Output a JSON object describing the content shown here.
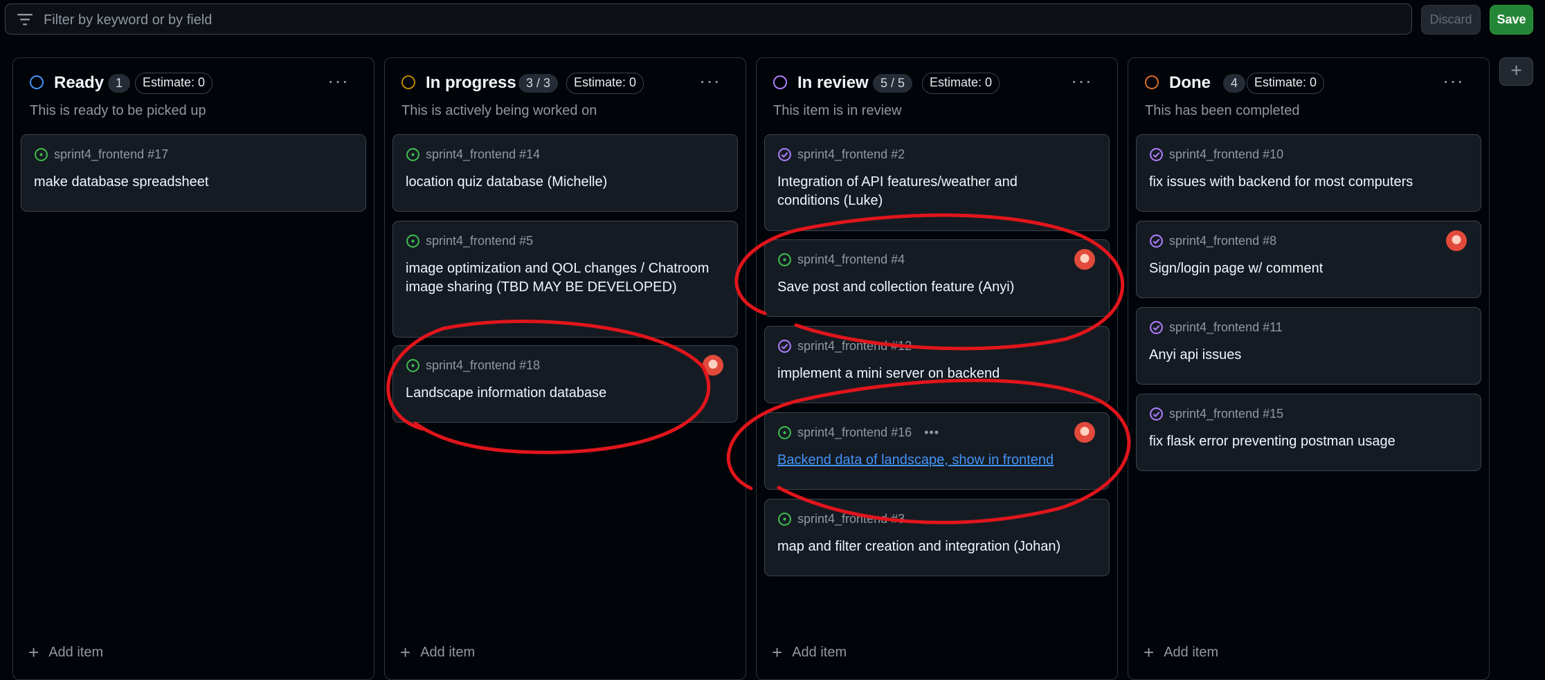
{
  "filter": {
    "placeholder": "Filter by keyword or by field"
  },
  "actions": {
    "discard_label": "Discard",
    "save_label": "Save"
  },
  "colors": {
    "ready": "#4493f8",
    "in_progress": "#bf8700",
    "in_review": "#ab7df8",
    "done": "#db6d28",
    "open_issue": "#3fb950",
    "closed_issue": "#ab7df8",
    "annotation": "#e0151c"
  },
  "columns": [
    {
      "id": "ready",
      "title": "Ready",
      "count": "1",
      "estimate": "Estimate: 0",
      "description": "This is ready to be picked up",
      "menu_icon": "kebab-horizontal-icon",
      "add_label": "Add item",
      "cards": [
        {
          "icon": "open-issue-icon",
          "repo": "sprint4_frontend #17",
          "title": "make database spreadsheet"
        }
      ]
    },
    {
      "id": "in-progress",
      "title": "In progress",
      "count": "3 / 3",
      "estimate": "Estimate: 0",
      "description": "This is actively being worked on",
      "menu_icon": "kebab-horizontal-icon",
      "add_label": "Add item",
      "cards": [
        {
          "icon": "open-issue-icon",
          "repo": "sprint4_frontend #14",
          "title": "location quiz database (Michelle)"
        },
        {
          "icon": "open-issue-icon",
          "repo": "sprint4_frontend #5",
          "title": "image optimization and QOL changes / Chatroom image sharing (TBD MAY BE DEVELOPED)"
        },
        {
          "icon": "open-issue-icon",
          "repo": "sprint4_frontend #18",
          "title": "Landscape information database",
          "assignee_avatar": "avatar-icon"
        }
      ]
    },
    {
      "id": "in-review",
      "title": "In review",
      "count": "5 / 5",
      "estimate": "Estimate: 0",
      "description": "This item is in review",
      "menu_icon": "kebab-horizontal-icon",
      "add_label": "Add item",
      "cards": [
        {
          "icon": "closed-issue-icon",
          "repo": "sprint4_frontend #2",
          "title": "Integration of API features/weather and conditions (Luke)"
        },
        {
          "icon": "open-issue-icon",
          "repo": "sprint4_frontend #4",
          "title": "Save post and collection feature (Anyi)",
          "assignee_avatar": "avatar-icon"
        },
        {
          "icon": "closed-issue-icon",
          "repo": "sprint4_frontend #12",
          "title": "implement a mini server on backend"
        },
        {
          "icon": "open-issue-icon",
          "repo": "sprint4_frontend #16",
          "title": "Backend data of landscape, show in frontend",
          "assignee_avatar": "avatar-icon",
          "hovered": true
        },
        {
          "icon": "open-issue-icon",
          "repo": "sprint4_frontend #3",
          "title": "map and filter creation and integration (Johan)"
        }
      ]
    },
    {
      "id": "done",
      "title": "Done",
      "count": "4",
      "estimate": "Estimate: 0",
      "description": "This has been completed",
      "menu_icon": "kebab-horizontal-icon",
      "add_label": "Add item",
      "cards": [
        {
          "icon": "closed-issue-icon",
          "repo": "sprint4_frontend #10",
          "title": "fix issues with backend for most computers"
        },
        {
          "icon": "closed-issue-icon",
          "repo": "sprint4_frontend #8",
          "title": "Sign/login page w/ comment",
          "assignee_avatar": "avatar-icon"
        },
        {
          "icon": "closed-issue-icon",
          "repo": "sprint4_frontend #11",
          "title": "Anyi api issues"
        },
        {
          "icon": "closed-issue-icon",
          "repo": "sprint4_frontend #15",
          "title": "fix flask error preventing postman usage"
        }
      ]
    }
  ],
  "card_menu_icon": "more-dots-icon",
  "add_column_icon": "plus-icon"
}
